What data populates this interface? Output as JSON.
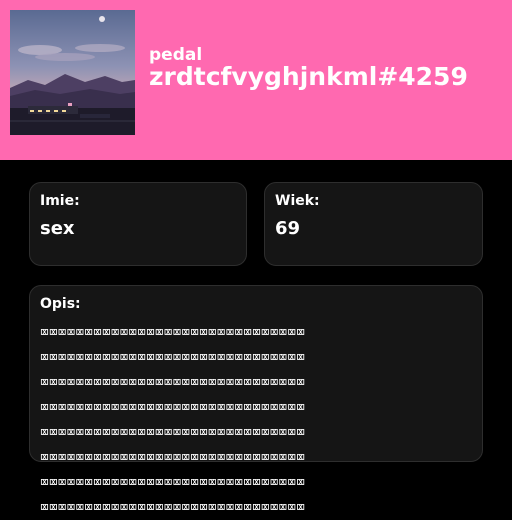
{
  "header": {
    "background_color": "#ff69b0",
    "display_name": "pedal",
    "username": "zrdtcfvyghjnkml#4259"
  },
  "fields": {
    "name": {
      "label": "Imie:",
      "value": "sex"
    },
    "age": {
      "label": "Wiek:",
      "value": "69"
    },
    "description": {
      "label": "Opis:",
      "value": "⌧⌧⌧⌧⌧⌧⌧⌧⌧⌧⌧⌧⌧⌧⌧⌧⌧⌧⌧⌧⌧⌧⌧⌧⌧⌧⌧⌧⌧⌧\n⌧⌧⌧⌧⌧⌧⌧⌧⌧⌧⌧⌧⌧⌧⌧⌧⌧⌧⌧⌧⌧⌧⌧⌧⌧⌧⌧⌧⌧⌧\n⌧⌧⌧⌧⌧⌧⌧⌧⌧⌧⌧⌧⌧⌧⌧⌧⌧⌧⌧⌧⌧⌧⌧⌧⌧⌧⌧⌧⌧⌧\n⌧⌧⌧⌧⌧⌧⌧⌧⌧⌧⌧⌧⌧⌧⌧⌧⌧⌧⌧⌧⌧⌧⌧⌧⌧⌧⌧⌧⌧⌧\n⌧⌧⌧⌧⌧⌧⌧⌧⌧⌧⌧⌧⌧⌧⌧⌧⌧⌧⌧⌧⌧⌧⌧⌧⌧⌧⌧⌧⌧⌧\n⌧⌧⌧⌧⌧⌧⌧⌧⌧⌧⌧⌧⌧⌧⌧⌧⌧⌧⌧⌧⌧⌧⌧⌧⌧⌧⌧⌧⌧⌧\n⌧⌧⌧⌧⌧⌧⌧⌧⌧⌧⌧⌧⌧⌧⌧⌧⌧⌧⌧⌧⌧⌧⌧⌧⌧⌧⌧⌧⌧⌧\n⌧⌧⌧⌧⌧⌧⌧⌧⌧⌧⌧⌧⌧⌧⌧⌧⌧⌧⌧⌧⌧⌧⌧⌧⌧⌧⌧⌧⌧⌧"
    }
  },
  "colors": {
    "page_background": "#000000",
    "card_background": "#151515",
    "card_border": "#2e2e2e",
    "text": "#ffffff"
  }
}
